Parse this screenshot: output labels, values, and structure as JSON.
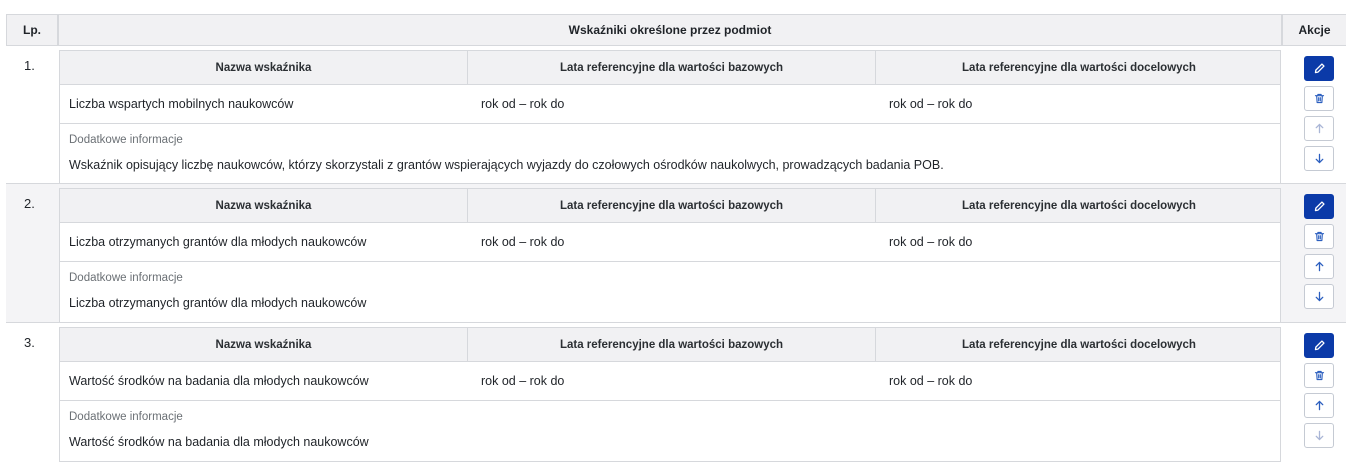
{
  "header": {
    "lp": "Lp.",
    "group": "Wskaźniki określone przez podmiot",
    "actions": "Akcje"
  },
  "columns": {
    "name": "Nazwa wskaźnika",
    "baseline_years": "Lata referencyjne dla wartości bazowych",
    "target_years": "Lata referencyjne dla wartości docelowych",
    "info_label": "Dodatkowe informacje"
  },
  "items": [
    {
      "number": "1.",
      "name": "Liczba wspartych mobilnych naukowców",
      "baseline_years": "rok od – rok do",
      "target_years": "rok od – rok do",
      "info": "Wskaźnik opisujący liczbę naukowców, którzy skorzystali z grantów wspierających wyjazdy do czołowych ośrodków naukolwych, prowadzących badania POB."
    },
    {
      "number": "2.",
      "name": "Liczba otrzymanych grantów dla młodych naukowców",
      "baseline_years": "rok od – rok do",
      "target_years": "rok od – rok do",
      "info": "Liczba otrzymanych grantów dla młodych naukowców"
    },
    {
      "number": "3.",
      "name": "Wartość środków na badania dla młodych naukowców",
      "baseline_years": "rok od – rok do",
      "target_years": "rok od – rok do",
      "info": "Wartość środków na badania dla młodych naukowców"
    }
  ],
  "icons": {
    "edit": "pencil-icon",
    "delete": "trash-icon",
    "up": "arrow-up-icon",
    "down": "arrow-down-icon"
  },
  "colors": {
    "primary": "#0b3aa8",
    "header_bg": "#f1f1f3",
    "border": "#d6d8dc",
    "muted_text": "#6b7075"
  }
}
